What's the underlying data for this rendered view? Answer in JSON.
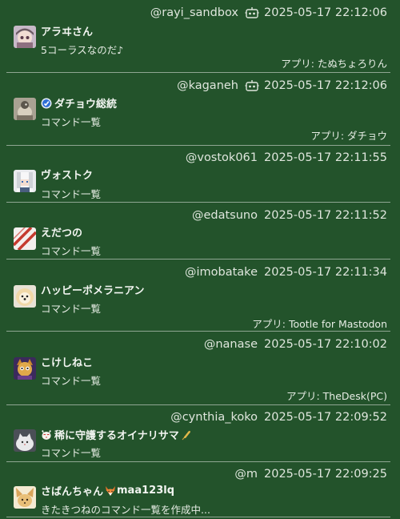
{
  "colors": {
    "background": "#23532b",
    "divider": "#8fa692",
    "text": "#e9eee8"
  },
  "posts": [
    {
      "account": "@rayi_sandbox",
      "is_bot": true,
      "timestamp": "2025-05-17 22:12:06",
      "display_name": "アラヰさん",
      "content": "5コーラスなのだ♪",
      "app_label": "アプリ: たぬちょろりん",
      "avatar": "raccoon-girl-avatar"
    },
    {
      "account": "@kaganeh",
      "is_bot": true,
      "timestamp": "2025-05-17 22:12:06",
      "display_name": "ダチョウ総統",
      "content": "コマンド一覧",
      "app_label": "アプリ: ダチョウ",
      "avatar": "ostrich-avatar",
      "name_prefix_icon": "blue-badge-icon"
    },
    {
      "account": "@vostok061",
      "is_bot": false,
      "timestamp": "2025-05-17 22:11:55",
      "display_name": "ヴォストク",
      "content": "コマンド一覧",
      "app_label": "",
      "avatar": "white-hair-avatar"
    },
    {
      "account": "@edatsuno",
      "is_bot": false,
      "timestamp": "2025-05-17 22:11:52",
      "display_name": "えだつの",
      "content": "コマンド一覧",
      "app_label": "",
      "avatar": "red-stripes-avatar"
    },
    {
      "account": "@imobatake",
      "is_bot": false,
      "timestamp": "2025-05-17 22:11:34",
      "display_name": "ハッピーポメラニアン",
      "content": "コマンド一覧",
      "app_label": "アプリ: Tootle for Mastodon",
      "avatar": "pomeranian-avatar"
    },
    {
      "account": "@nanase",
      "is_bot": false,
      "timestamp": "2025-05-17 22:10:02",
      "display_name": "こけしねこ",
      "content": "コマンド一覧",
      "app_label": "アプリ: TheDesk(PC)",
      "avatar": "cat-girl-avatar"
    },
    {
      "account": "@cynthia_koko",
      "is_bot": false,
      "timestamp": "2025-05-17 22:09:52",
      "display_name": "稀に守護するオイナリサマ",
      "content": "コマンド一覧",
      "app_label": "",
      "avatar": "white-cat-avatar",
      "name_prefix_icon": "fox-mask-icon",
      "name_suffix_icon": "wheat-icon"
    },
    {
      "account": "@m",
      "is_bot": false,
      "timestamp": "2025-05-17 22:09:25",
      "display_name": "さばんちゃん",
      "display_name_suffix": "maa123lq",
      "content": "きたきつねのコマンド一覧を作成中...",
      "app_label": "",
      "avatar": "fennec-avatar",
      "name_mid_icon": "fox-icon"
    }
  ]
}
